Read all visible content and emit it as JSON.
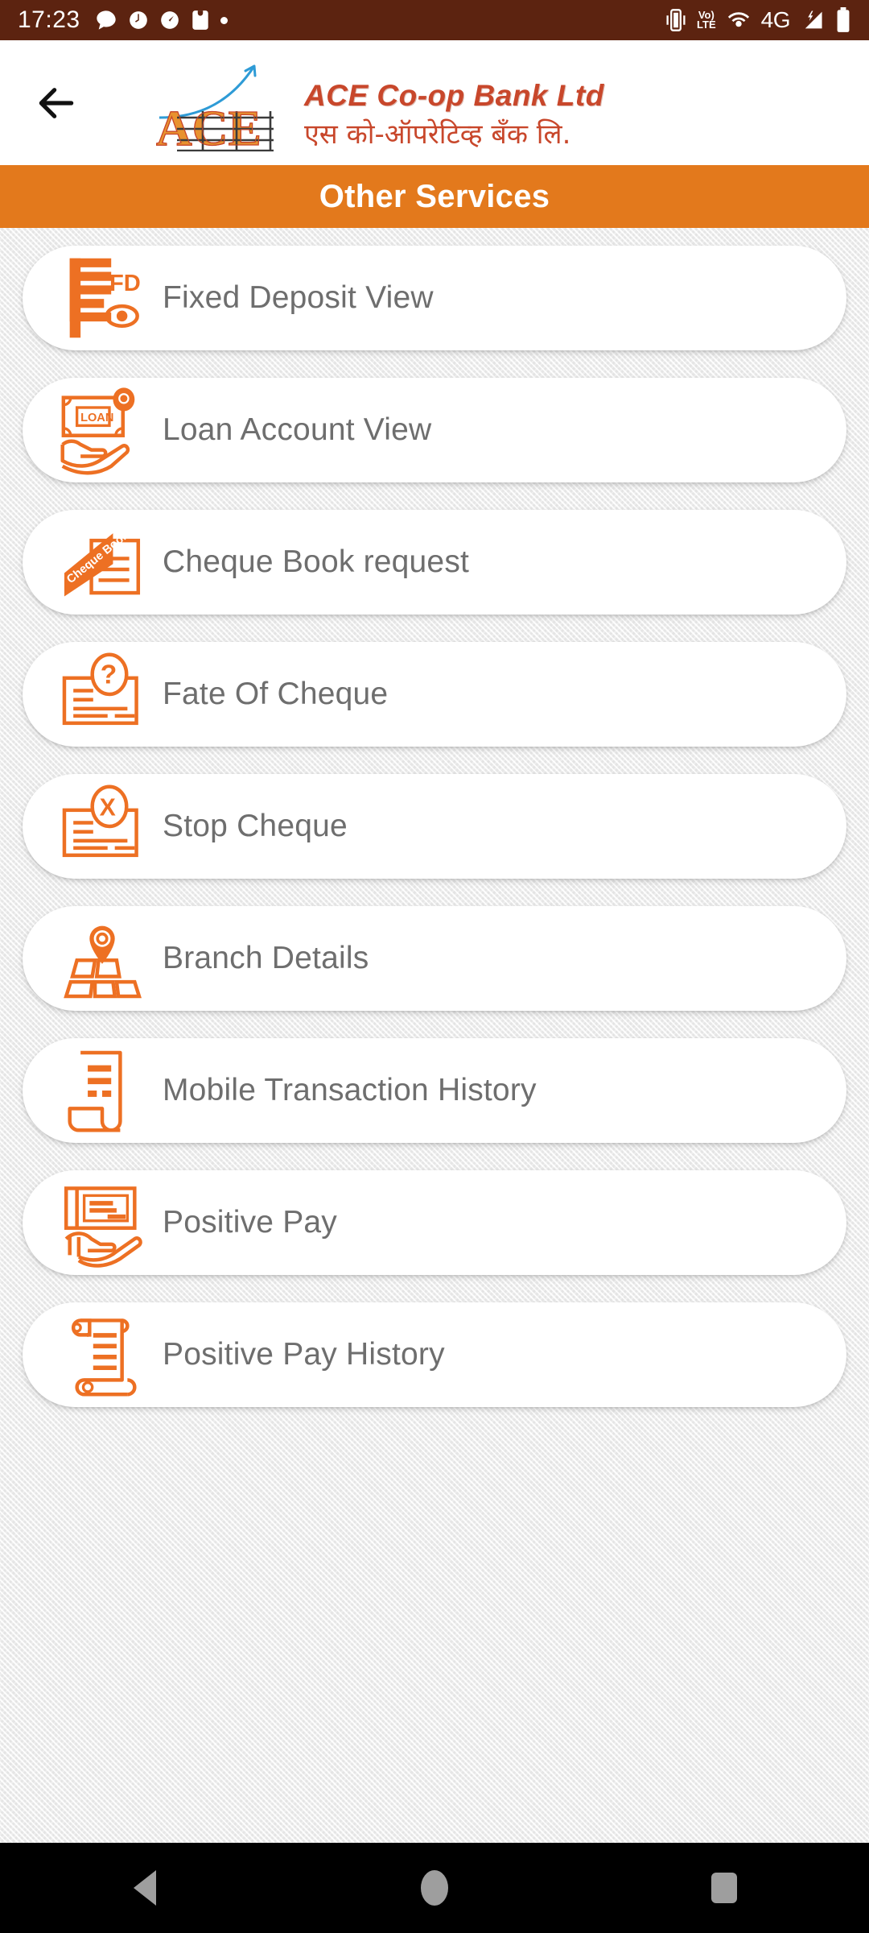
{
  "status_bar": {
    "time": "17:23",
    "network_label": "4G",
    "volte_top": "Vo)",
    "volte_bottom": "LTE",
    "left_icons": [
      "chat-bubble-icon",
      "clock-icon",
      "speedometer-icon",
      "shopping-bag-icon",
      "dot-icon"
    ],
    "right_icons": [
      "vibrate-icon",
      "volte-icon",
      "hotspot-icon",
      "signal-icon",
      "battery-icon"
    ],
    "background_color": "#5C2310"
  },
  "header": {
    "back_icon": "arrow-left-icon",
    "logo_monogram": "ACE",
    "logo_name_en": "ACE  Co-op Bank Ltd",
    "logo_name_hi": "एस  को-ऑपरेटिव्ह  बँक  लि.",
    "logo_color": "#C8472B",
    "monogram_color": "#E8922F",
    "curve_color": "#2E9BD6"
  },
  "title_bar": {
    "title": "Other Services",
    "background_color": "#E3791C",
    "text_color": "#FFFFFF"
  },
  "theme": {
    "icon_orange": "#ED7023",
    "label_gray": "#6E6E6E",
    "card_background": "#FFFFFF",
    "page_background": "#EDEDED"
  },
  "services": [
    {
      "label": "Fixed Deposit View",
      "icon": "fixed-deposit-document-icon",
      "badge": "FD"
    },
    {
      "label": "Loan Account View",
      "icon": "loan-note-in-hand-icon",
      "badge": "LOAN"
    },
    {
      "label": "Cheque Book request",
      "icon": "cheque-book-icon",
      "badge": "Cheque Book"
    },
    {
      "label": "Fate Of Cheque",
      "icon": "cheque-question-mark-icon",
      "badge": "?"
    },
    {
      "label": "Stop Cheque",
      "icon": "cheque-cross-mark-icon",
      "badge": "X"
    },
    {
      "label": "Branch Details",
      "icon": "map-location-pin-icon",
      "badge": ""
    },
    {
      "label": "Mobile Transaction History",
      "icon": "receipt-scroll-icon",
      "badge": ""
    },
    {
      "label": "Positive Pay",
      "icon": "cheque-in-hand-icon",
      "badge": ""
    },
    {
      "label": "Positive Pay History",
      "icon": "scroll-document-icon",
      "badge": ""
    }
  ],
  "nav_bar": {
    "back_label": "back-button",
    "home_label": "home-button",
    "recents_label": "recents-button",
    "background_color": "#000000"
  }
}
